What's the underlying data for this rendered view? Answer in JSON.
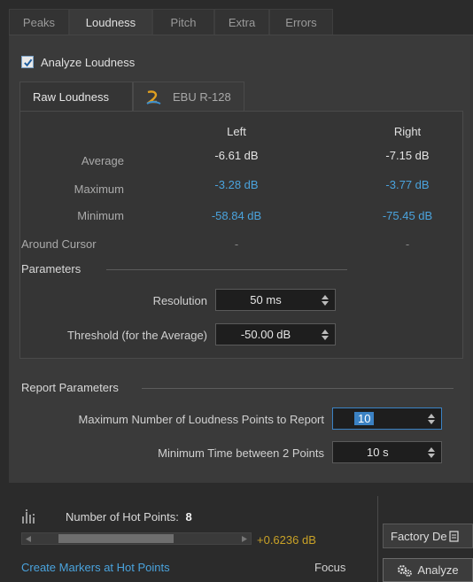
{
  "tabs": [
    "Peaks",
    "Loudness",
    "Pitch",
    "Extra",
    "Errors"
  ],
  "active_tab": "Loudness",
  "analyze_loudness": {
    "label": "Analyze Loudness",
    "checked": true
  },
  "inner_tabs": [
    "Raw Loudness",
    "EBU R-128"
  ],
  "active_inner_tab": "Raw Loudness",
  "table": {
    "headers": [
      "Left",
      "Right"
    ],
    "rows": [
      {
        "label": "Average",
        "left": "-6.61 dB",
        "right": "-7.15 dB"
      },
      {
        "label": "Maximum",
        "left": "-3.28 dB",
        "right": "-3.77 dB"
      },
      {
        "label": "Minimum",
        "left": "-58.84 dB",
        "right": "-75.45 dB"
      },
      {
        "label": "Around Cursor",
        "left": "-",
        "right": "-"
      }
    ]
  },
  "parameters": {
    "title": "Parameters",
    "resolution_label": "Resolution",
    "resolution_value": "50 ms",
    "threshold_label": "Threshold (for the Average)",
    "threshold_value": "-50.00 dB"
  },
  "report": {
    "title": "Report Parameters",
    "max_points_label": "Maximum Number of Loudness Points to Report",
    "max_points_value": "10",
    "min_time_label": "Minimum Time between 2 Points",
    "min_time_value": "10 s"
  },
  "hot_points": {
    "label": "Number of Hot Points:",
    "count": "8",
    "delta": "+0.6236 dB"
  },
  "factory_button": "Factory De",
  "create_markers_link": "Create Markers at Hot Points",
  "focus_label": "Focus",
  "analyze_button": "Analyze",
  "colors": {
    "accent_blue": "#4aa3dd",
    "gold": "#c9a227",
    "background": "#2b2b2b"
  },
  "icons": [
    "checkmark-icon",
    "ebu-icon",
    "spin-arrows-icon",
    "hot-points-icon",
    "factory-preset-icon",
    "gears-icon"
  ]
}
